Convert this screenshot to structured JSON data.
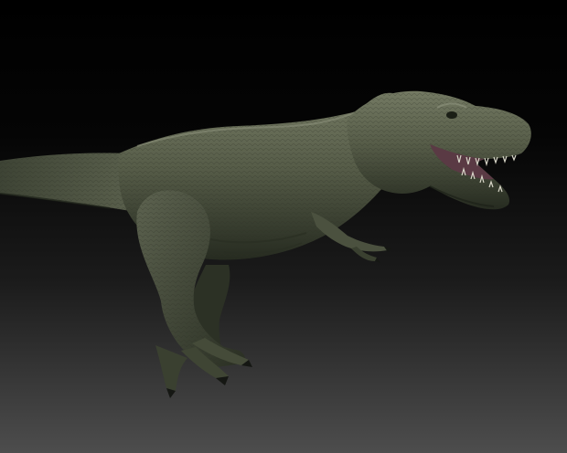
{
  "scene": {
    "subject_icon": "t-rex-model",
    "colors": {
      "background_top": "#000000",
      "background_bottom": "#4d4d4d",
      "skin_light": "#6f745e",
      "skin_mid": "#4b513f",
      "skin_dark": "#23281d",
      "mouth": "#5a3a44",
      "teeth": "#d8d6c8"
    }
  }
}
